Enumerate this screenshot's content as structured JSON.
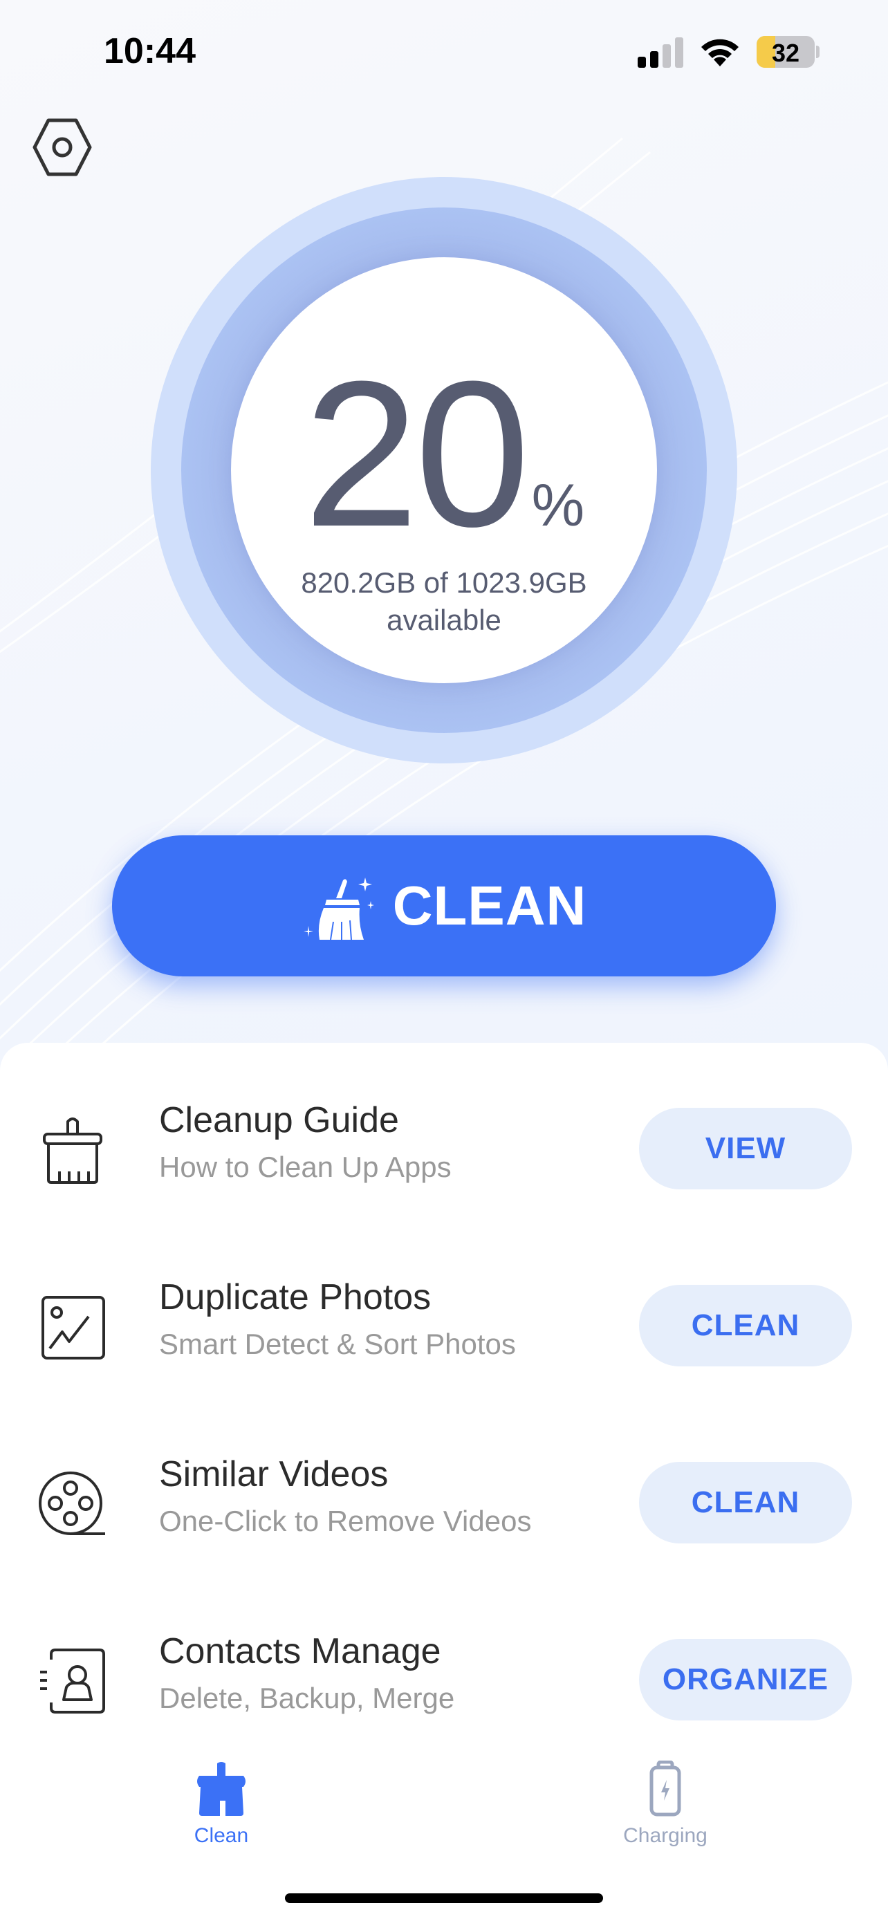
{
  "status_bar": {
    "time": "10:44",
    "signal_bars_active": 2,
    "signal_bars_total": 4,
    "battery_level": 32,
    "battery_label": "32",
    "battery_color": "#f5cb4a"
  },
  "header": {
    "settings_icon": "hexagon-gear-icon"
  },
  "storage": {
    "percent_value": "20",
    "percent_symbol": "%",
    "percent_fraction": 0.2,
    "detail_line1": "820.2GB of 1023.9GB",
    "detail_line2": "available",
    "available_gb": 820.2,
    "total_gb": 1023.9
  },
  "main_button": {
    "label": "CLEAN",
    "icon": "broom-sparkle-icon",
    "color": "#3b71f6"
  },
  "features": [
    {
      "title": "Cleanup Guide",
      "subtitle": "How to Clean Up Apps",
      "action": "VIEW",
      "icon": "brush-icon"
    },
    {
      "title": "Duplicate Photos",
      "subtitle": "Smart Detect & Sort Photos",
      "action": "CLEAN",
      "icon": "photo-icon"
    },
    {
      "title": "Similar Videos",
      "subtitle": "One-Click to Remove Videos",
      "action": "CLEAN",
      "icon": "film-reel-icon"
    },
    {
      "title": "Contacts Manage",
      "subtitle": "Delete, Backup, Merge",
      "action": "ORGANIZE",
      "icon": "contact-card-icon"
    }
  ],
  "tabbar": {
    "tabs": [
      {
        "label": "Clean",
        "icon": "brush-filled-icon",
        "active": true,
        "color": "#3b71f6"
      },
      {
        "label": "Charging",
        "icon": "battery-charging-icon",
        "active": false,
        "color": "#9ca7bf"
      }
    ]
  }
}
